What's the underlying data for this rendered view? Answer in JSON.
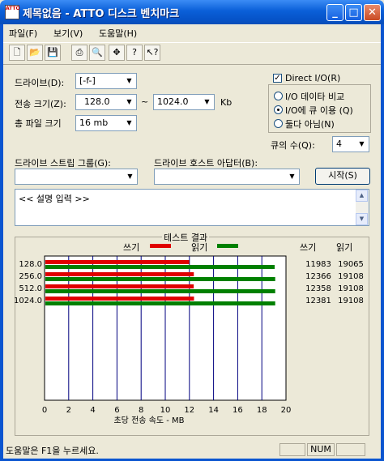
{
  "window": {
    "title": "제목없음 - ATTO 디스크 벤치마크",
    "icon_text": "ATTO"
  },
  "menu": {
    "items": [
      "파일(F)",
      "보기(V)",
      "도움말(H)"
    ]
  },
  "toolbar": {
    "icons": [
      "new-icon",
      "open-icon",
      "save-icon",
      "print-icon",
      "print-preview-icon",
      "move-icon",
      "help-icon",
      "context-help-icon"
    ]
  },
  "form": {
    "drive_label": "드라이브(D):",
    "drive_value": "[-f-]",
    "transfer_label": "전송 크기(Z):",
    "transfer_from": "128.0",
    "transfer_tilde": "~",
    "transfer_to": "1024.0",
    "transfer_unit": "Kb",
    "total_label": "총 파일 크기",
    "total_value": "16 mb",
    "direct_io_label": "Direct I/O(R)",
    "radio_options": [
      "I/O 데이타 비교",
      "I/O에 큐 이용 (Q)",
      "둘다 아님(N)"
    ],
    "queue_label": "큐의 수(Q):",
    "queue_value": "4",
    "stripe_label": "드라이브 스트립 그룹(G):",
    "stripe_value": "",
    "adapter_label": "드라이브 호스트 아답터(B):",
    "adapter_value": "",
    "start_button": "시작(S)",
    "description": "<< 설명 입력 >>"
  },
  "results": {
    "title": "테스트 결과",
    "legend_write": "쓰기",
    "legend_read": "읽기",
    "col_write": "쓰기",
    "col_read": "읽기",
    "xlabel": "초당 전송 속도 - MB",
    "colors": {
      "write": "#e00000",
      "read": "#008000",
      "grid": "#00007f"
    }
  },
  "chart_data": {
    "type": "bar",
    "categories": [
      "128.0",
      "256.0",
      "512.0",
      "1024.0"
    ],
    "series": [
      {
        "name": "쓰기",
        "values": [
          11983,
          12366,
          12358,
          12381
        ]
      },
      {
        "name": "읽기",
        "values": [
          19065,
          19108,
          19108,
          19108
        ]
      }
    ],
    "xticks": [
      0,
      2,
      4,
      6,
      8,
      10,
      12,
      14,
      16,
      18,
      20
    ],
    "xlim": [
      0,
      20
    ],
    "xlabel": "초당 전송 속도 - MB"
  },
  "status": {
    "text": "도움말은 F1을 누르세요.",
    "num": "NUM"
  }
}
